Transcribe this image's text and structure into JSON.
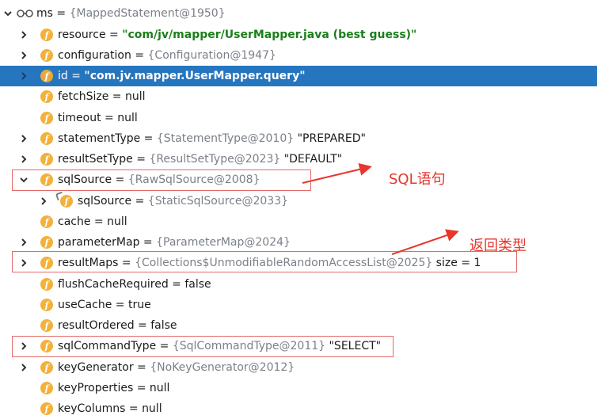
{
  "root": {
    "name": "ms",
    "eq": " = ",
    "ref": "{MappedStatement@1950}"
  },
  "rows": [
    {
      "name": "resource",
      "eq": " = ",
      "str": "\"com/jv/mapper/UserMapper.java (best guess)\""
    },
    {
      "name": "configuration",
      "eq": " = ",
      "ref": "{Configuration@1947}"
    },
    {
      "name": "id",
      "eq": " = ",
      "str": "\"com.jv.mapper.UserMapper.query\""
    },
    {
      "name": "fetchSize",
      "eq": " = ",
      "lit": "null"
    },
    {
      "name": "timeout",
      "eq": " = ",
      "lit": "null"
    },
    {
      "name": "statementType",
      "eq": " = ",
      "ref": "{StatementType@2010}",
      "lit": " \"PREPARED\""
    },
    {
      "name": "resultSetType",
      "eq": " = ",
      "ref": "{ResultSetType@2023}",
      "lit": " \"DEFAULT\""
    },
    {
      "name": "sqlSource",
      "eq": " = ",
      "ref": "{RawSqlSource@2008}"
    },
    {
      "name": "sqlSource",
      "eq": " = ",
      "ref": "{StaticSqlSource@2033}"
    },
    {
      "name": "cache",
      "eq": " = ",
      "lit": "null"
    },
    {
      "name": "parameterMap",
      "eq": " = ",
      "ref": "{ParameterMap@2024}"
    },
    {
      "name": "resultMaps",
      "eq": " = ",
      "ref": "{Collections$UnmodifiableRandomAccessList@2025}",
      "lit": "  size = 1"
    },
    {
      "name": "flushCacheRequired",
      "eq": " = ",
      "lit": "false"
    },
    {
      "name": "useCache",
      "eq": " = ",
      "lit": "true"
    },
    {
      "name": "resultOrdered",
      "eq": " = ",
      "lit": "false"
    },
    {
      "name": "sqlCommandType",
      "eq": " = ",
      "ref": "{SqlCommandType@2011}",
      "lit": " \"SELECT\""
    },
    {
      "name": "keyGenerator",
      "eq": " = ",
      "ref": "{NoKeyGenerator@2012}"
    },
    {
      "name": "keyProperties",
      "eq": " = ",
      "lit": "null"
    },
    {
      "name": "keyColumns",
      "eq": " = ",
      "lit": "null"
    }
  ],
  "annotations": {
    "sql": "SQL语句",
    "return_type": "返回类型"
  },
  "colors": {
    "selection": "#2675bf",
    "field_icon": "#f2b13b",
    "string_value": "#1a7f1a",
    "reference": "#7b8088",
    "annotation": "#e8362b"
  }
}
